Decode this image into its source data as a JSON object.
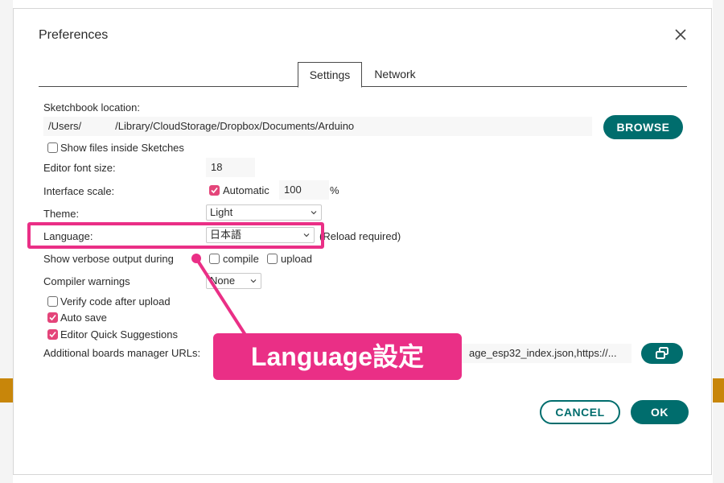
{
  "dialog": {
    "title": "Preferences"
  },
  "tabs": [
    {
      "label": "Settings",
      "active": true
    },
    {
      "label": "Network",
      "active": false
    }
  ],
  "sketchbook": {
    "label": "Sketchbook location:",
    "path_user": "/Users/",
    "path_rest": "/Library/CloudStorage/Dropbox/Documents/Arduino",
    "browse_label": "BROWSE"
  },
  "show_files": {
    "label": "Show files inside Sketches",
    "checked": false
  },
  "font_size": {
    "label": "Editor font size:",
    "value": "18"
  },
  "interface_scale": {
    "label": "Interface scale:",
    "automatic_label": "Automatic",
    "automatic_checked": true,
    "value": "100",
    "unit": "%"
  },
  "theme": {
    "label": "Theme:",
    "value": "Light"
  },
  "language": {
    "label": "Language:",
    "value": "日本語",
    "note": "(Reload required)"
  },
  "verbose": {
    "label": "Show verbose output during",
    "compile_label": "compile",
    "compile_checked": false,
    "upload_label": "upload",
    "upload_checked": false
  },
  "compiler_warnings": {
    "label": "Compiler warnings",
    "value": "None"
  },
  "verify_code": {
    "label": "Verify code after upload",
    "checked": false
  },
  "auto_save": {
    "label": "Auto save",
    "checked": true
  },
  "quick_suggestions": {
    "label": "Editor Quick Suggestions",
    "checked": true
  },
  "boards_urls": {
    "label": "Additional boards manager URLs:",
    "value": "age_esp32_index.json,https://..."
  },
  "footer": {
    "cancel_label": "CANCEL",
    "ok_label": "OK"
  },
  "annotation": {
    "callout_text": "Language設定"
  },
  "colors": {
    "accent": "#006d6d",
    "highlight": "#ea2f86",
    "checkbox_on": "#e4457a"
  }
}
